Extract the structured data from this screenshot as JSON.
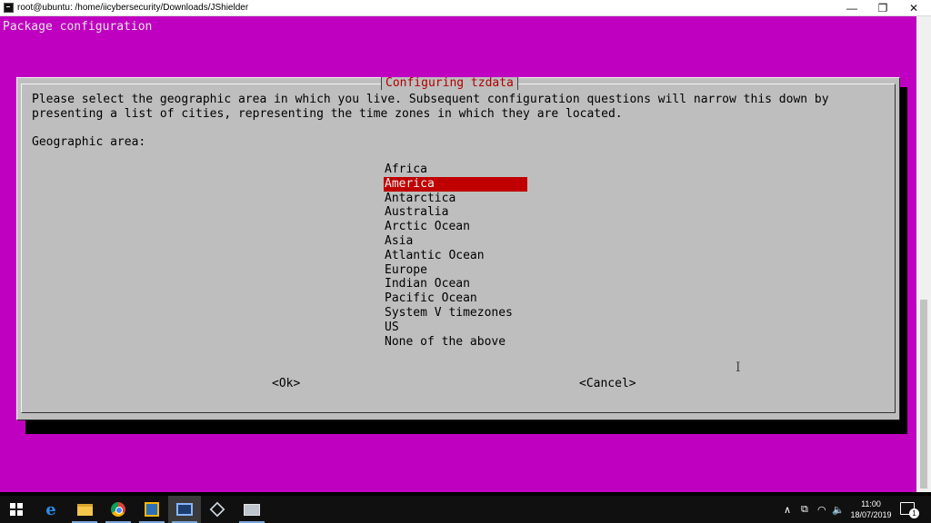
{
  "window": {
    "title": "root@ubuntu: /home/iicybersecurity/Downloads/JShielder",
    "buttons": {
      "minimize": "—",
      "restore": "❐",
      "close": "✕"
    }
  },
  "terminal": {
    "header": "Package configuration"
  },
  "dialog": {
    "title": "Configuring tzdata",
    "prompt": "Please select the geographic area in which you live. Subsequent configuration questions will narrow this down by\npresenting a list of cities, representing the time zones in which they are located.",
    "area_label": "Geographic area:",
    "options": [
      "Africa",
      "America",
      "Antarctica",
      "Australia",
      "Arctic Ocean",
      "Asia",
      "Atlantic Ocean",
      "Europe",
      "Indian Ocean",
      "Pacific Ocean",
      "System V timezones",
      "US",
      "None of the above"
    ],
    "selected_index": 1,
    "ok_label": "<Ok>",
    "cancel_label": "<Cancel>"
  },
  "taskbar": {
    "clock_time": "11:00",
    "clock_date": "18/07/2019",
    "notification_count": "1",
    "tray_chevron": "∧"
  },
  "colors": {
    "terminal_bg": "#c000c0",
    "dialog_bg": "#bebebe",
    "highlight": "#c00000",
    "title_text": "#b00000"
  }
}
